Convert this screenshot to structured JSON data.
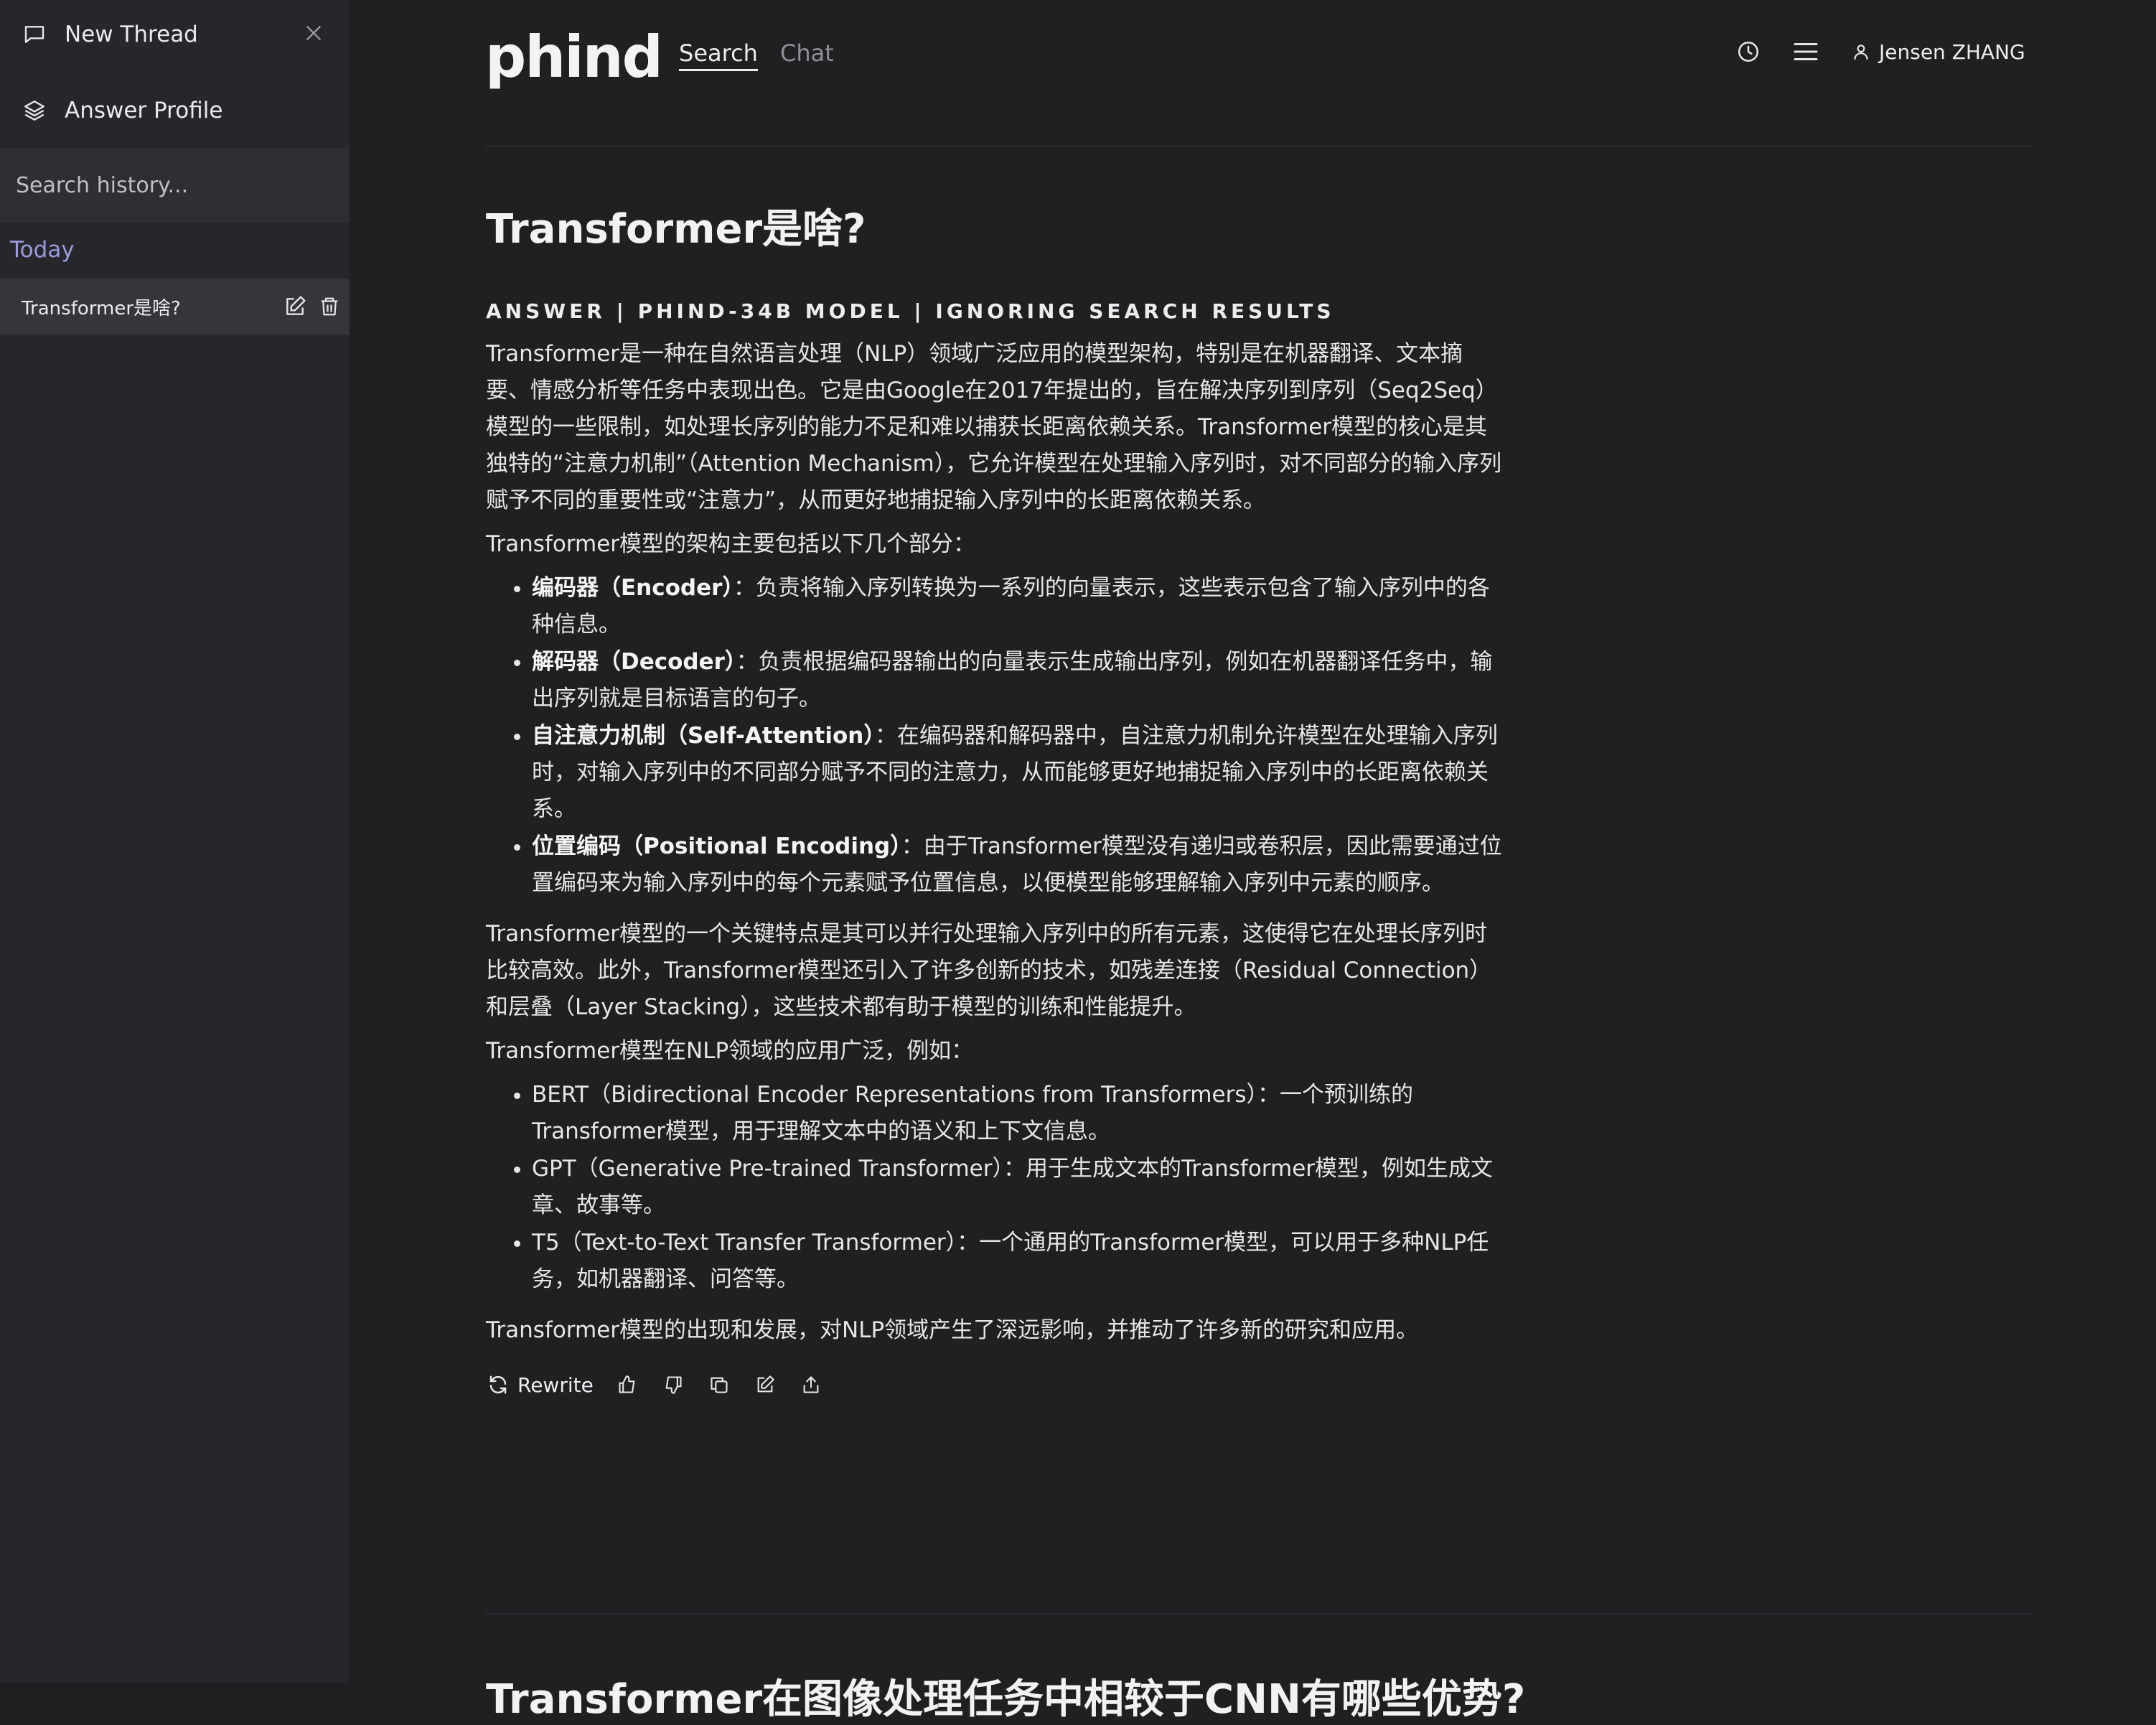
{
  "sidebar": {
    "new_thread": "New Thread",
    "answer_profile": "Answer Profile",
    "search_placeholder": "Search history...",
    "today_label": "Today",
    "history": [
      {
        "title": "Transformer是啥?"
      }
    ],
    "icons": {
      "new_thread": "chat-bubble-icon",
      "close": "close-icon",
      "answer_profile": "layers-icon",
      "edit": "edit-icon",
      "delete": "trash-icon"
    }
  },
  "header": {
    "logo": "phind",
    "tabs": [
      {
        "label": "Search",
        "active": true
      },
      {
        "label": "Chat",
        "active": false
      }
    ],
    "icons": [
      "history-clock-icon",
      "menu-icon"
    ],
    "user": "Jensen ZHANG"
  },
  "main": {
    "question": "Transformer是啥?",
    "answer_header": "ANSWER | PHIND-34B MODEL | IGNORING SEARCH RESULTS",
    "p1": "Transformer是一种在自然语言处理（NLP）领域广泛应用的模型架构，特别是在机器翻译、文本摘要、情感分析等任务中表现出色。它是由Google在2017年提出的，旨在解决序列到序列（Seq2Seq）模型的一些限制，如处理长序列的能力不足和难以捕获长距离依赖关系。Transformer模型的核心是其独特的“注意力机制”（Attention Mechanism），它允许模型在处理输入序列时，对不同部分的输入序列赋予不同的重要性或“注意力”，从而更好地捕捉输入序列中的长距离依赖关系。",
    "p2": "Transformer模型的架构主要包括以下几个部分：",
    "components": [
      {
        "term": "编码器（Encoder）",
        "desc": "：负责将输入序列转换为一系列的向量表示，这些表示包含了输入序列中的各种信息。"
      },
      {
        "term": "解码器（Decoder）",
        "desc": "：负责根据编码器输出的向量表示生成输出序列，例如在机器翻译任务中，输出序列就是目标语言的句子。"
      },
      {
        "term": "自注意力机制（Self-Attention）",
        "desc": "：在编码器和解码器中，自注意力机制允许模型在处理输入序列时，对输入序列中的不同部分赋予不同的注意力，从而能够更好地捕捉输入序列中的长距离依赖关系。"
      },
      {
        "term": "位置编码（Positional Encoding）",
        "desc": "：由于Transformer模型没有递归或卷积层，因此需要通过位置编码来为输入序列中的每个元素赋予位置信息，以便模型能够理解输入序列中元素的顺序。"
      }
    ],
    "p3": "Transformer模型的一个关键特点是其可以并行处理输入序列中的所有元素，这使得它在处理长序列时比较高效。此外，Transformer模型还引入了许多创新的技术，如残差连接（Residual Connection）和层叠（Layer Stacking），这些技术都有助于模型的训练和性能提升。",
    "p4": "Transformer模型在NLP领域的应用广泛，例如：",
    "applications": [
      "BERT（Bidirectional Encoder Representations from Transformers）：一个预训练的Transformer模型，用于理解文本中的语义和上下文信息。",
      "GPT（Generative Pre-trained Transformer）：用于生成文本的Transformer模型，例如生成文章、故事等。",
      "T5（Text-to-Text Transfer Transformer）：一个通用的Transformer模型，可以用于多种NLP任务，如机器翻译、问答等。"
    ],
    "p5": "Transformer模型的出现和发展，对NLP领域产生了深远影响，并推动了许多新的研究和应用。",
    "actions": {
      "rewrite": "Rewrite",
      "icons": [
        "thumbs-up-icon",
        "thumbs-down-icon",
        "copy-icon",
        "edit-icon",
        "share-icon"
      ]
    },
    "next_question": "Transformer在图像处理任务中相较于CNN有哪些优势?"
  }
}
